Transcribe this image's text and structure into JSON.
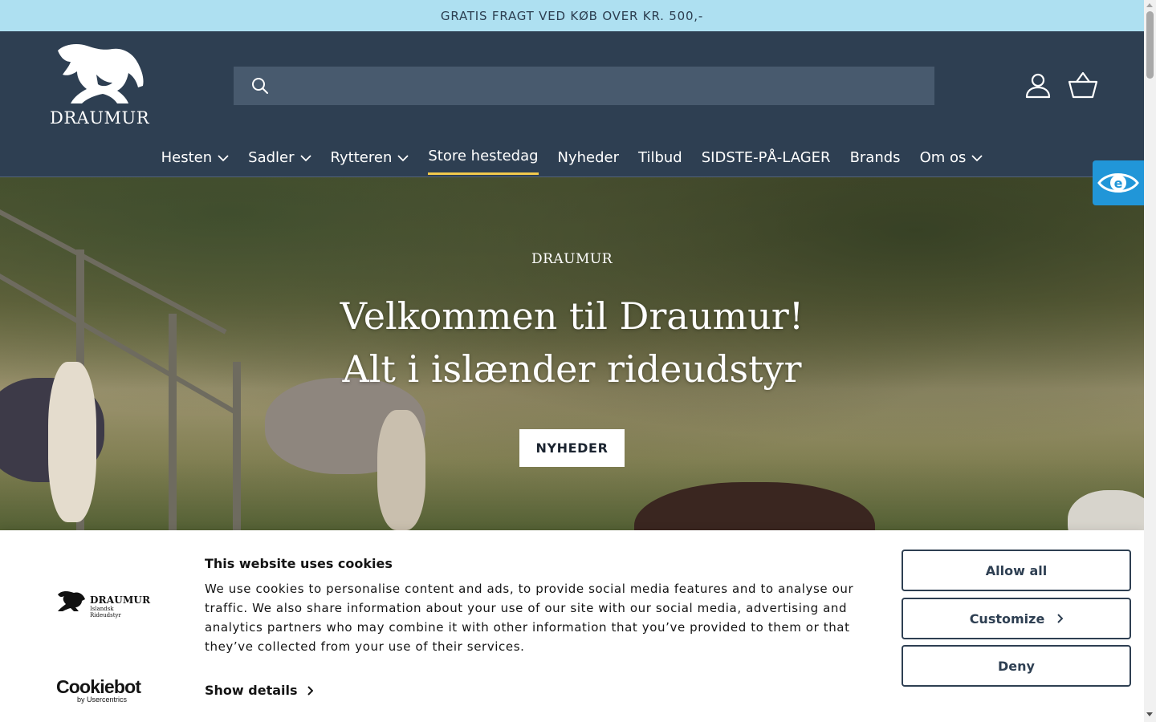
{
  "announcement": {
    "text": "GRATIS FRAGT VED KØB OVER KR. 500,-"
  },
  "header": {
    "logo_text": "DRAUMUR",
    "search": {
      "placeholder": "",
      "value": ""
    },
    "icons": {
      "account": "account-icon",
      "cart": "basket-icon",
      "search": "search-icon"
    },
    "colors": {
      "background": "#2e3f52",
      "active_underline": "#f2c94c"
    }
  },
  "nav": {
    "items": [
      {
        "label": "Hesten",
        "has_dropdown": true
      },
      {
        "label": "Sadler",
        "has_dropdown": true
      },
      {
        "label": "Rytteren",
        "has_dropdown": true
      },
      {
        "label": "Store hestedag",
        "has_dropdown": false,
        "active": true
      },
      {
        "label": "Nyheder",
        "has_dropdown": false
      },
      {
        "label": "Tilbud",
        "has_dropdown": false
      },
      {
        "label": "SIDSTE-PÅ-LAGER",
        "has_dropdown": false
      },
      {
        "label": "Brands",
        "has_dropdown": false
      },
      {
        "label": "Om os",
        "has_dropdown": true
      }
    ]
  },
  "hero": {
    "subtitle": "DRAUMUR",
    "title_line1": "Velkommen til Draumur!",
    "title_line2": "Alt i islænder rideudstyr",
    "button_label": "NYHEDER"
  },
  "accessibility": {
    "icon": "eye-accessibility-icon",
    "color": "#2196d8"
  },
  "cookie_banner": {
    "logo_text": "DRAUMUR",
    "logo_subtext": "Islandsk Rideudstyr",
    "title": "This website uses cookies",
    "body": "We use cookies to personalise content and ads, to provide social media features and to analyse our traffic. We also share information about your use of our site with our social media, advertising and analytics partners who may combine it with other information that you’ve provided to them or that they’ve collected from your use of their services.",
    "show_details": "Show details",
    "buttons": {
      "allow_all": "Allow all",
      "customize": "Customize",
      "deny": "Deny"
    },
    "cookiebot_main": "Cookiebot",
    "cookiebot_sub": "by Usercentrics"
  }
}
